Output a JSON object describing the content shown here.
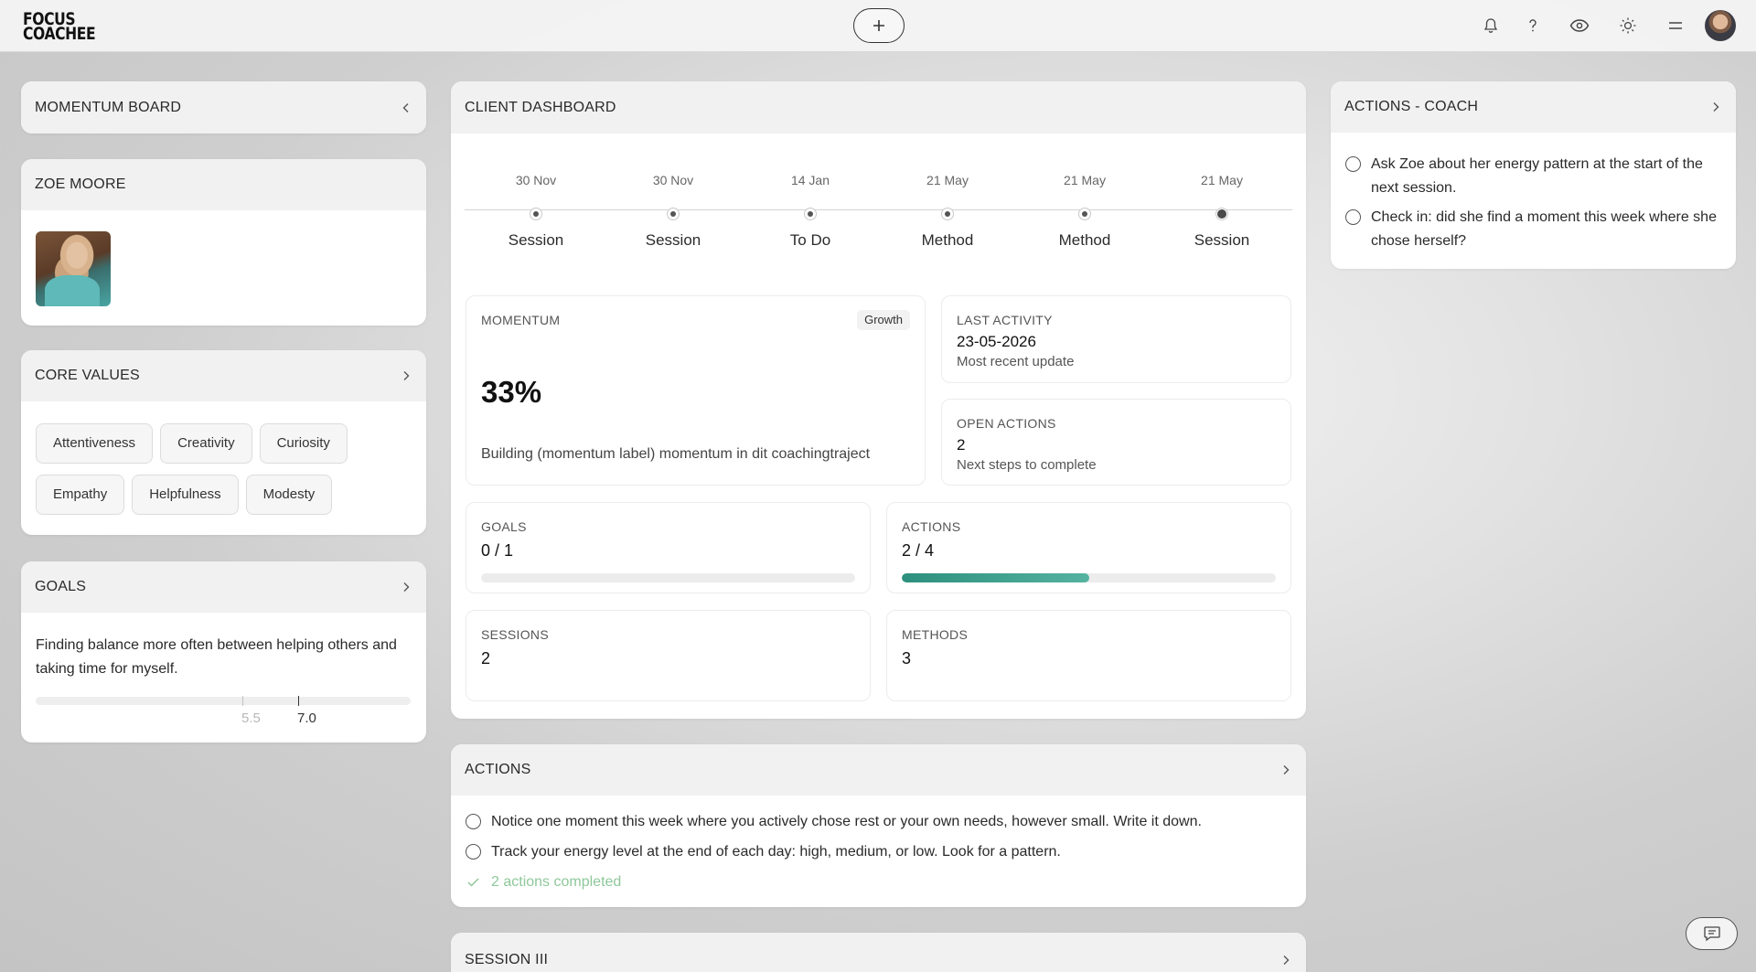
{
  "brand": {
    "line1": "FOCUS",
    "line2": "COACHEE"
  },
  "topbar": {
    "add_icon": "plus-icon",
    "icons": [
      "bell-icon",
      "help-icon",
      "eye-icon",
      "sun-icon",
      "menu-icon"
    ]
  },
  "momentum_board": {
    "title": "MOMENTUM BOARD"
  },
  "client": {
    "name": "ZOE MOORE"
  },
  "core_values": {
    "title": "CORE VALUES",
    "items": [
      "Attentiveness",
      "Creativity",
      "Curiosity",
      "Empathy",
      "Helpfulness",
      "Modesty"
    ]
  },
  "goals_card": {
    "title": "GOALS",
    "text": "Finding balance more often between helping others and taking time for myself.",
    "previous_score": "5.5",
    "current_score": "7.0"
  },
  "dashboard": {
    "title": "CLIENT DASHBOARD",
    "timeline": [
      {
        "date": "30 Nov",
        "label": "Session"
      },
      {
        "date": "30 Nov",
        "label": "Session"
      },
      {
        "date": "14 Jan",
        "label": "To Do"
      },
      {
        "date": "21 May",
        "label": "Method"
      },
      {
        "date": "21 May",
        "label": "Method"
      },
      {
        "date": "21 May",
        "label": "Session"
      }
    ],
    "momentum": {
      "label": "MOMENTUM",
      "badge": "Growth",
      "value": "33%",
      "description": "Building (momentum label) momentum in dit coachingtraject"
    },
    "last_activity": {
      "label": "LAST ACTIVITY",
      "value": "23-05-2026",
      "sub": "Most recent update"
    },
    "open_actions": {
      "label": "OPEN ACTIONS",
      "value": "2",
      "sub": "Next steps to complete"
    },
    "goals": {
      "label": "GOALS",
      "value": "0 / 1",
      "progress": 0
    },
    "actions": {
      "label": "ACTIONS",
      "value": "2 / 4",
      "progress": 0.5
    },
    "sessions": {
      "label": "SESSIONS",
      "value": "2"
    },
    "methods": {
      "label": "METHODS",
      "value": "3"
    }
  },
  "actions_card": {
    "title": "ACTIONS",
    "items": [
      "Notice one moment this week where you actively chose rest or your own needs, however small. Write it down.",
      "Track your energy level at the end of each day: high, medium, or low. Look for a pattern."
    ],
    "completed": "2 actions completed"
  },
  "session_card": {
    "title": "SESSION III"
  },
  "coach_actions": {
    "title": "ACTIONS - COACH",
    "items": [
      "Ask Zoe about her energy pattern at the start of the next session.",
      "Check in: did she find a moment this week where she chose herself?"
    ]
  },
  "colors": {
    "accent": "#2d8f7d",
    "completed": "#8fc79a"
  }
}
